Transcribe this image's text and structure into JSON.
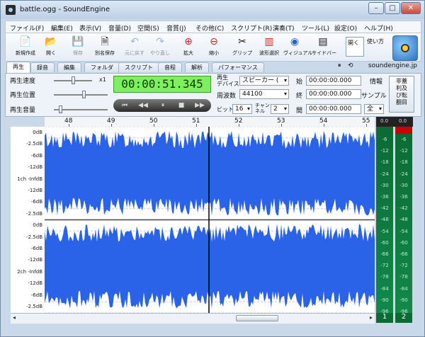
{
  "window": {
    "title": "battle.ogg - SoundEngine",
    "min": "–",
    "max": "□",
    "close": "✕"
  },
  "menu": [
    "ファイル(F)",
    "編集(E)",
    "表示(V)",
    "音量(D)",
    "空間(S)",
    "音質(J)",
    "その他(C)",
    "スクリプト(R)",
    "演奏(T)",
    "ツール(L)",
    "設定(O)",
    "ヘルプ(H)"
  ],
  "toolbar": [
    {
      "label": "新規作成",
      "icon": "📄",
      "state": "enabled"
    },
    {
      "label": "開く",
      "icon": "📂",
      "state": "enabled"
    },
    {
      "label": "保存",
      "icon": "💾",
      "state": "disabled"
    },
    {
      "label": "別名保存",
      "icon": "🗎",
      "state": "enabled"
    },
    {
      "label": "元に戻す",
      "icon": "↶",
      "state": "disabled"
    },
    {
      "label": "やり直し",
      "icon": "↷",
      "state": "disabled"
    },
    {
      "label": "拡大",
      "icon": "⊕",
      "state": "enabled"
    },
    {
      "label": "縮小",
      "icon": "⊖",
      "state": "enabled"
    },
    {
      "label": "グリップ",
      "icon": "✂",
      "state": "enabled"
    },
    {
      "label": "波形選択",
      "icon": "▥",
      "state": "enabled"
    },
    {
      "label": "ヴィジュアル",
      "icon": "◉",
      "state": "enabled"
    },
    {
      "label": "サイドバー",
      "icon": "▤",
      "state": "enabled"
    }
  ],
  "toolbar_right": {
    "open_label": "開く",
    "usage_label": "使い方"
  },
  "tabs": [
    "再生",
    "録音",
    "編集",
    "フォルダ",
    "スクリプト",
    "音程",
    "解析",
    "パフォーマンス"
  ],
  "site": "soundengine.jp",
  "small_ctrl": [
    "⏸",
    "⟲"
  ],
  "play_controls": {
    "speed_label": "再生速度",
    "speed_value": "x1",
    "position_label": "再生位置",
    "volume_label": "再生音量",
    "speed_level": 0.5,
    "position_level": 0.55,
    "volume_level": 0.12
  },
  "time_display": "00:00:51.345",
  "transport": [
    "⏮",
    "◀◀",
    "⏸",
    "■",
    "▶▶"
  ],
  "device": {
    "label": "再生\nデバイス",
    "value": "スピーカー ("
  },
  "freq": {
    "label": "周波数",
    "value": "44100"
  },
  "bits": {
    "label": "ビット",
    "value": "16"
  },
  "channels": {
    "label": "チャン\nネル",
    "value": "2"
  },
  "start": {
    "label": "始",
    "value": "00:00:00.000"
  },
  "end": {
    "label": "終",
    "value": "00:00:00.000"
  },
  "between": {
    "label": "間",
    "value": "00:00:00.000"
  },
  "info_label": "情報",
  "sample_label": "サンプル",
  "all_value": "全",
  "side_button": "非蓋\n利及\nび転\n翻目",
  "ruler": [
    "48",
    "49",
    "50",
    "51",
    "52",
    "53",
    "54",
    "55"
  ],
  "db_labels": [
    "0dB",
    "-2.5dB",
    "-6dB",
    "-12dB",
    "1ch -InfdB",
    "-12dB",
    "-6dB",
    "-2.5dB",
    "0dB",
    "-2.5dB",
    "-6dB",
    "-12dB",
    "2ch -InfdB",
    "-12dB",
    "-6dB",
    "-2.5dB"
  ],
  "meter_header": [
    "0.0",
    "0.0"
  ],
  "meter_scale": [
    "-6",
    "-12",
    "-18",
    "-24",
    "-30",
    "-36",
    "-42",
    "-48",
    "-54",
    "-60",
    "-66",
    "-72",
    "-78",
    "-84",
    "-90",
    "-96"
  ],
  "meter_numbers": [
    "1",
    "2"
  ],
  "colors": {
    "wave": "#2a62e8",
    "time_bg": "#7cf05f",
    "meter": "#0e7a3f",
    "cursor": "#000000"
  }
}
